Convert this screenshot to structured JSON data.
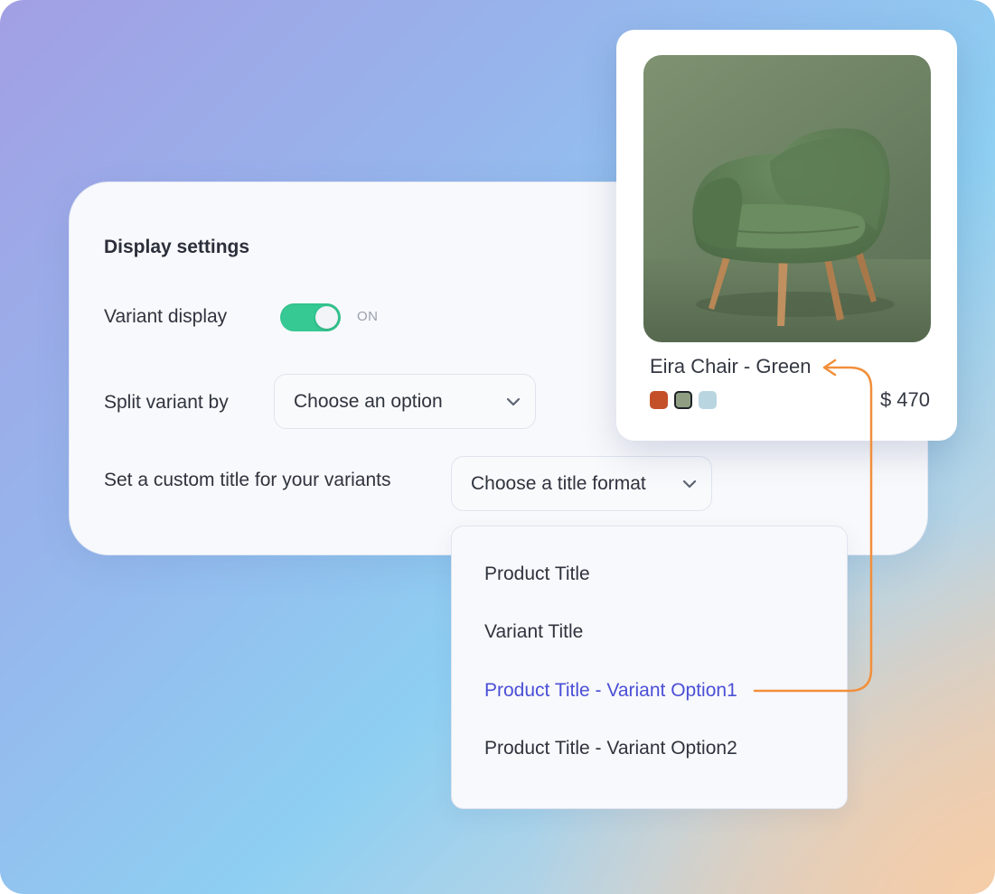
{
  "settings": {
    "title": "Display settings",
    "variant_display": {
      "label": "Variant display",
      "state": "ON",
      "enabled": true
    },
    "split_variant": {
      "label": "Split variant by",
      "placeholder": "Choose an option"
    },
    "custom_title": {
      "label": "Set a custom title for your variants",
      "placeholder": "Choose a title format"
    }
  },
  "dropdown": {
    "options": [
      {
        "label": "Product Title"
      },
      {
        "label": "Variant Title"
      },
      {
        "label": "Product Title - Variant Option1",
        "highlighted": true
      },
      {
        "label": "Product Title - Variant Option2"
      }
    ]
  },
  "product": {
    "name": "Eira Chair - Green",
    "price": "$ 470",
    "swatches": [
      {
        "color": "#c4502a",
        "selected": false
      },
      {
        "color": "#8f9e83",
        "selected": true
      },
      {
        "color": "#b9d6e0",
        "selected": false
      }
    ]
  },
  "colors": {
    "accent": "#36c993",
    "highlight": "#4b4fd6",
    "arrow": "#f28f3b"
  }
}
